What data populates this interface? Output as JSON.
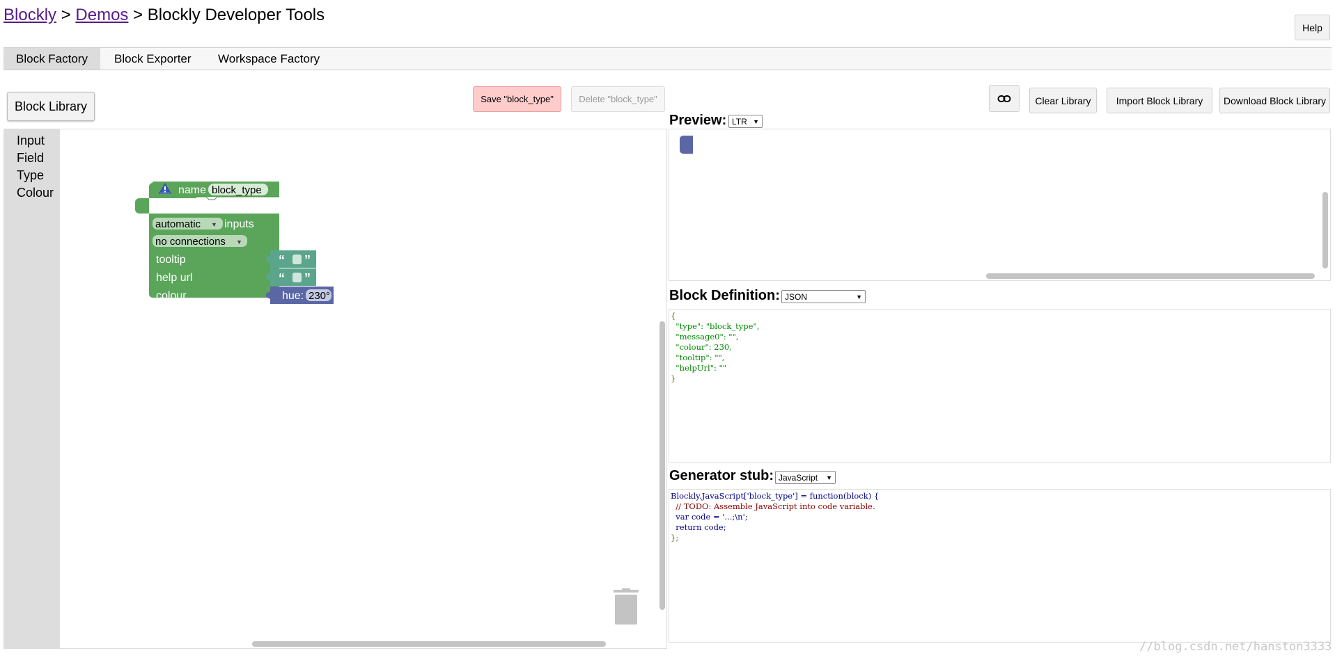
{
  "breadcrumb": {
    "link1": "Blockly",
    "sep1": ">",
    "link2": "Demos",
    "sep2": ">",
    "current": "Blockly Developer Tools"
  },
  "help_label": "Help",
  "tabs": [
    {
      "label": "Block Factory",
      "active": true
    },
    {
      "label": "Block Exporter",
      "active": false
    },
    {
      "label": "Workspace Factory",
      "active": false
    }
  ],
  "toolbar": {
    "block_library": "Block Library",
    "save": "Save \"block_type\"",
    "delete": "Delete \"block_type\"",
    "link_icon": "link-icon",
    "clear_library": "Clear Library",
    "import_library": "Import Block Library",
    "download_library": "Download Block Library"
  },
  "categories": [
    "Input",
    "Field",
    "Type",
    "Colour"
  ],
  "factory_block": {
    "name_label": "name",
    "name_value": "block_type",
    "inputs_label": "inputs",
    "inline_value": "automatic",
    "inline_suffix": "inputs",
    "connections_value": "no connections",
    "tooltip_label": "tooltip",
    "helpurl_label": "help url",
    "colour_label": "colour",
    "quote_open": "“",
    "quote_close": "”",
    "hue_label": "hue:",
    "hue_value": "230°",
    "colors": {
      "main": "#5ba55b",
      "text_block": "#5ba58c",
      "hue_block": "#5b67a5"
    }
  },
  "preview": {
    "label": "Preview:",
    "direction": "LTR"
  },
  "block_definition": {
    "label": "Block Definition:",
    "format": "JSON",
    "lines": [
      "{",
      "  \"type\": \"block_type\",",
      "  \"message0\": \"\",",
      "  \"colour\": 230,",
      "  \"tooltip\": \"\",",
      "  \"helpUrl\": \"\"",
      "}"
    ]
  },
  "generator": {
    "label": "Generator stub:",
    "language": "JavaScript",
    "lines": [
      "Blockly.JavaScript['block_type'] = function(block) {",
      "  // TODO: Assemble JavaScript into code variable.",
      "  var code = '...;\\n';",
      "  return code;",
      "};"
    ]
  },
  "watermark": "//blog.csdn.net/hanston3333"
}
